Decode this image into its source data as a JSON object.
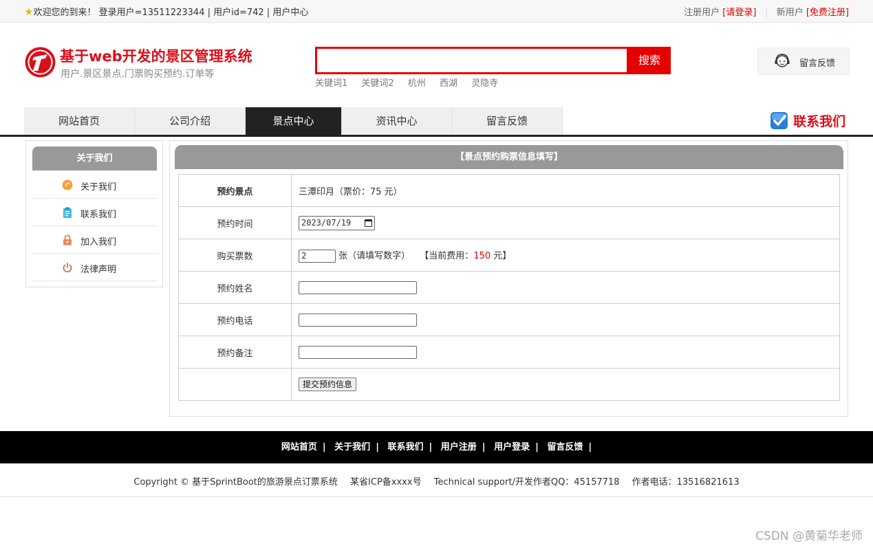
{
  "topbar": {
    "welcome": "欢迎您的到来！ 登录用户=13511223344 | 用户id=742 | 用户中心",
    "registered_label": "注册用户",
    "login_link": "[请登录]",
    "new_user_label": "新用户",
    "register_link": "[免费注册]"
  },
  "header": {
    "site_title": "基于web开发的景区管理系统",
    "site_subtitle": "用户.景区景点.门票购买预约.订单等",
    "search_button": "搜索",
    "keywords": [
      "关键词1",
      "关键词2",
      "杭州",
      "西湖",
      "灵隐寺"
    ],
    "feedback_label": "留言反馈"
  },
  "nav": {
    "items": [
      "网站首页",
      "公司介绍",
      "景点中心",
      "资讯中心",
      "留言反馈"
    ],
    "active_index": 2,
    "contact_label": "联系我们"
  },
  "sidebar": {
    "title": "关于我们",
    "items": [
      {
        "label": "关于我们",
        "icon": "orange-circle-icon"
      },
      {
        "label": "联系我们",
        "icon": "clipboard-icon"
      },
      {
        "label": "加入我们",
        "icon": "lock-icon"
      },
      {
        "label": "法律声明",
        "icon": "power-icon"
      }
    ]
  },
  "form": {
    "title": "【景点预约购票信息填写】",
    "spot_label": "预约景点",
    "spot_value": "三潭印月（票价：75 元）",
    "date_label": "预约时间",
    "date_value": "2023/07/19",
    "qty_label": "购买票数",
    "qty_value": "2",
    "qty_hint": "张（请填写数字）",
    "fee_prefix": "【当前费用：",
    "fee_value": "150",
    "fee_suffix": " 元】",
    "name_label": "预约姓名",
    "phone_label": "预约电话",
    "note_label": "预约备注",
    "submit_label": "提交预约信息"
  },
  "footer": {
    "links": [
      "网站首页",
      "关于我们",
      "联系我们",
      "用户注册",
      "用户登录",
      "留言反馈"
    ],
    "copyright": "Copyright © 基于SprintBoot的旅游景点订票系统",
    "icp": "某省ICP备xxxx号",
    "support": "Technical support/开发作者QQ：45157718",
    "phone": "作者电话：13516821613"
  },
  "watermark": "CSDN @黄菊华老师",
  "colors": {
    "brand_red": "#e50000",
    "nav_active": "#222222",
    "panel_header": "#999999"
  }
}
